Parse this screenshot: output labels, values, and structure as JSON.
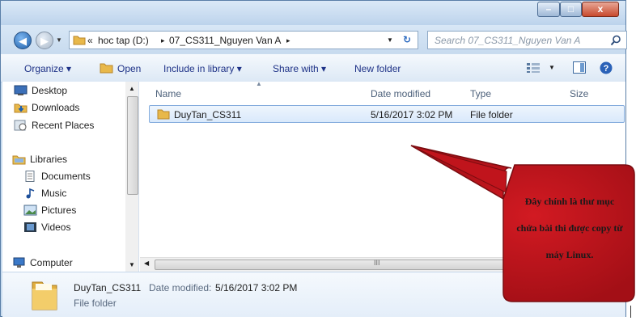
{
  "window": {
    "controls": {
      "minimize": "–",
      "maximize": "□",
      "close": "x"
    }
  },
  "navigation": {
    "back_icon": "back-arrow-icon",
    "forward_icon": "forward-arrow-icon",
    "breadcrumb_overflow": "«",
    "breadcrumb": [
      "hoc tap (D:)",
      "07_CS311_Nguyen Van A"
    ],
    "separator": "▸",
    "search_placeholder": "Search 07_CS311_Nguyen Van A"
  },
  "toolbar": {
    "organize": "Organize ▾",
    "open": "Open",
    "include_in_library": "Include in library ▾",
    "share_with": "Share with ▾",
    "new_folder": "New folder"
  },
  "sidebar": {
    "items": [
      {
        "label": "Desktop",
        "icon": "desktop-icon"
      },
      {
        "label": "Downloads",
        "icon": "downloads-icon"
      },
      {
        "label": "Recent Places",
        "icon": "recent-places-icon"
      },
      {
        "label": "Libraries",
        "icon": "libraries-icon"
      },
      {
        "label": "Documents",
        "icon": "documents-icon"
      },
      {
        "label": "Music",
        "icon": "music-icon"
      },
      {
        "label": "Pictures",
        "icon": "pictures-icon"
      },
      {
        "label": "Videos",
        "icon": "videos-icon"
      },
      {
        "label": "Computer",
        "icon": "computer-icon"
      }
    ]
  },
  "file_list": {
    "columns": [
      "Name",
      "Date modified",
      "Type",
      "Size"
    ],
    "rows": [
      {
        "name": "DuyTan_CS311",
        "date_modified": "5/16/2017 3:02 PM",
        "type": "File folder",
        "size": ""
      }
    ],
    "hscroll_grip": "III"
  },
  "details_pane": {
    "name": "DuyTan_CS311",
    "date_label": "Date modified:",
    "date_value": "5/16/2017 3:02 PM",
    "type": "File folder"
  },
  "callout": {
    "lines": [
      "Đây chính là thư mục",
      "chứa bài thi được copy từ",
      "máy Linux."
    ],
    "fill_color": "#c0141c"
  }
}
